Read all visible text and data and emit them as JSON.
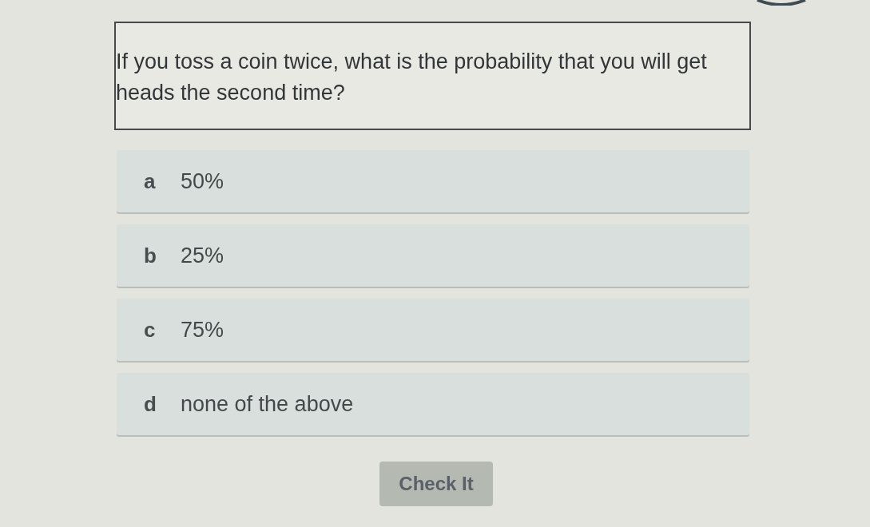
{
  "question": {
    "text": "If you toss a coin twice, what is the probability that you will get heads the second time?"
  },
  "options": [
    {
      "letter": "a",
      "text": "50%"
    },
    {
      "letter": "b",
      "text": "25%"
    },
    {
      "letter": "c",
      "text": "75%"
    },
    {
      "letter": "d",
      "text": "none of the above"
    }
  ],
  "check_button": {
    "label": "Check It"
  }
}
